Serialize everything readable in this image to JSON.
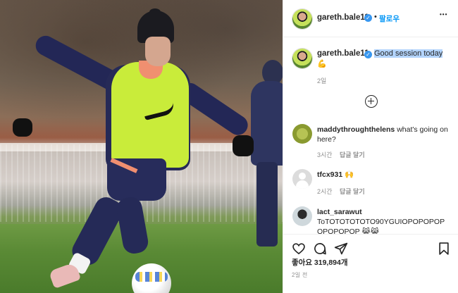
{
  "post": {
    "username": "gareth.bale11",
    "verified_glyph": "✓",
    "dot": "•",
    "follow_label": "팔로우",
    "more_label": "•••",
    "caption": {
      "text": "Good session today",
      "emoji": "💪",
      "time": "2일"
    }
  },
  "comments": [
    {
      "username": "maddythroughthelens",
      "text": "what's going on here?",
      "time": "3시간",
      "reply_label": "답글 달기"
    },
    {
      "username": "tfcx931",
      "text": "🙌",
      "time": "2시간",
      "reply_label": "답글 달기"
    },
    {
      "username": "lact_sarawut",
      "text": "ToTOTOTOTOTO90YGUIOPOPOPOPOPOPOPOP",
      "emoji": "😹😹"
    }
  ],
  "actions": {
    "like_icon": "heart-icon",
    "comment_icon": "comment-icon",
    "share_icon": "share-icon",
    "save_icon": "bookmark-icon"
  },
  "likes_label": "좋아요 319,894개",
  "posted_label": "2일 전",
  "colors": {
    "link": "#0095f6",
    "verified": "#3897f0",
    "selection": "#b3d4fc"
  }
}
